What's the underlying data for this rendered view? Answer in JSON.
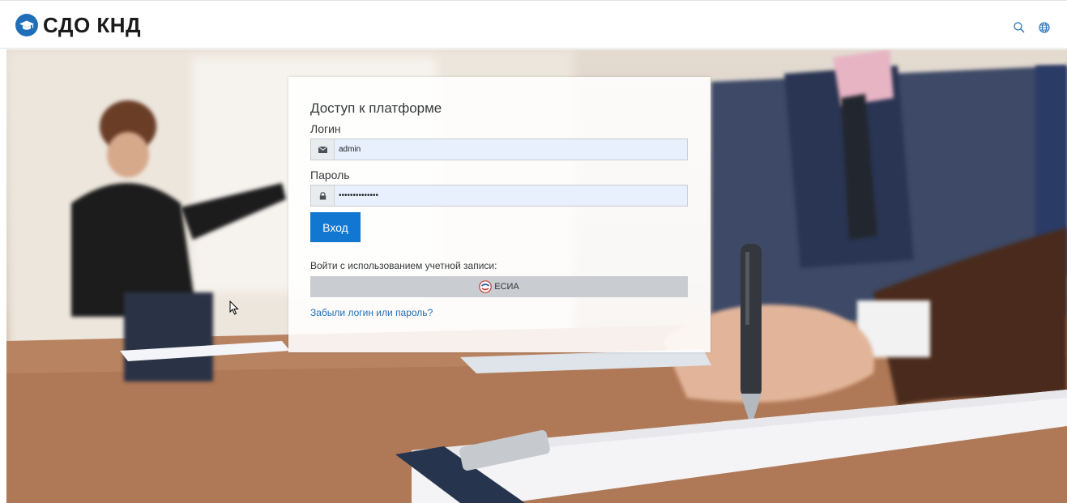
{
  "header": {
    "site_name": "СДО КНД",
    "icons": [
      "graduation-cap-icon",
      "search-icon",
      "globe-icon"
    ]
  },
  "login": {
    "title": "Доступ к платформе",
    "username_label": "Логин",
    "username_value": "admin",
    "password_label": "Пароль",
    "password_value": "••••••••••••••",
    "submit_label": "Вход",
    "alt_login_label": "Войти с использованием учетной записи:",
    "esia_label": "ЕСИА",
    "forgot_label": "Забыли логин или пароль?"
  },
  "colors": {
    "brand": "#1f6fb8",
    "button": "#1177d1"
  }
}
